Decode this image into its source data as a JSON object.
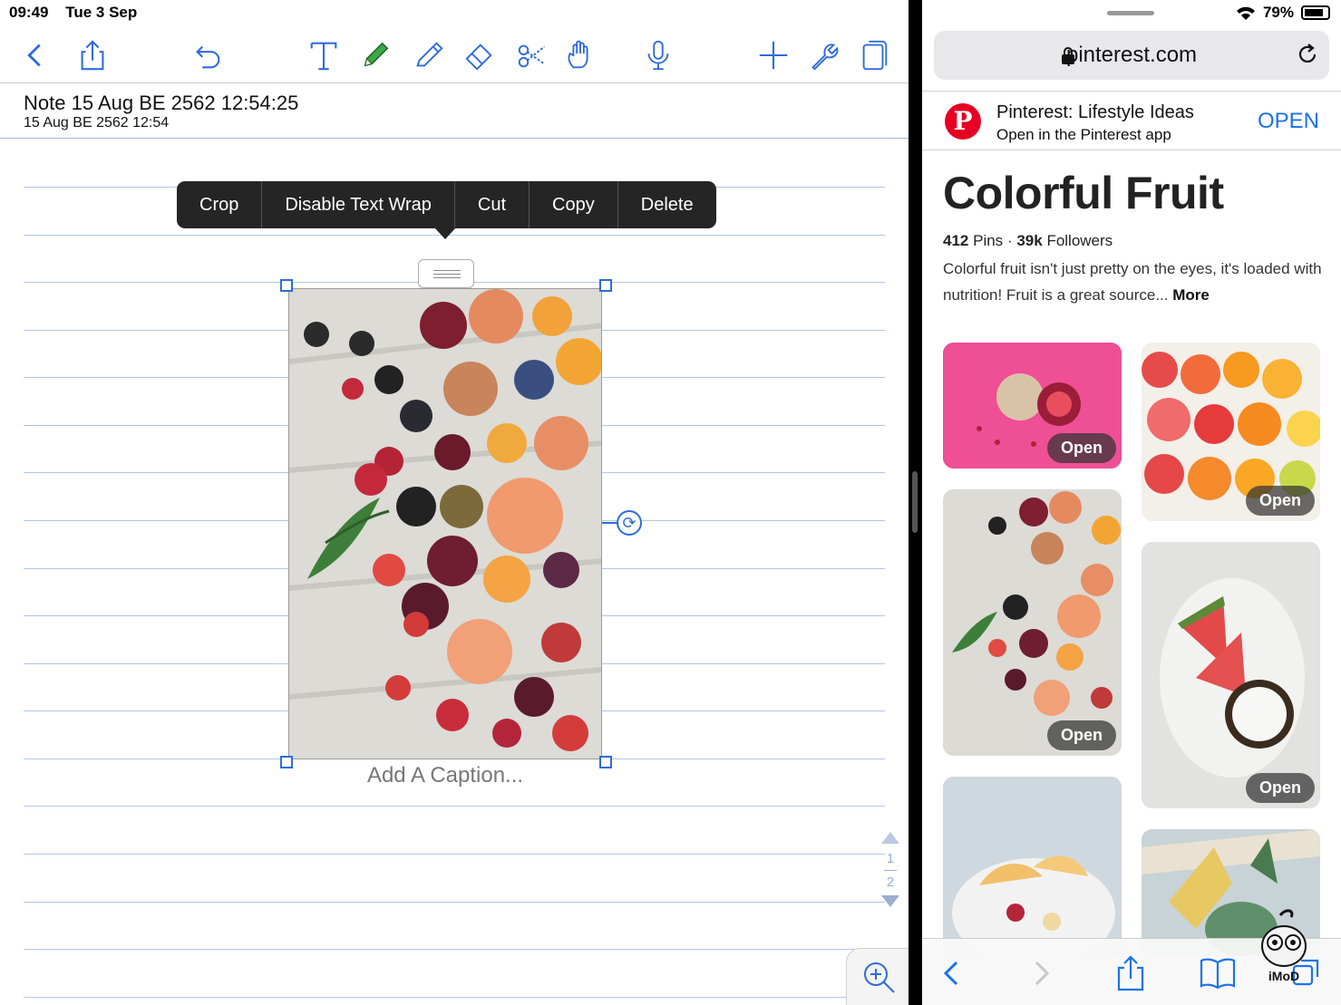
{
  "status_left": {
    "time": "09:49",
    "date": "Tue 3 Sep"
  },
  "status_right": {
    "battery": "79%"
  },
  "notes_app": {
    "note_title": "Note 15 Aug BE 2562 12:54:25",
    "note_date": "15 Aug BE 2562 12:54",
    "context_menu": [
      "Crop",
      "Disable Text Wrap",
      "Cut",
      "Copy",
      "Delete"
    ],
    "caption_placeholder": "Add A Caption...",
    "pager": {
      "page_a": "1",
      "page_b": "2"
    }
  },
  "safari": {
    "url": "pinterest.com",
    "banner": {
      "title": "Pinterest: Lifestyle Ideas",
      "subtitle": "Open in the Pinterest app",
      "open": "OPEN"
    },
    "board": {
      "title": "Colorful Fruit",
      "pins_count": "412",
      "pins_label": "Pins",
      "separator": "·",
      "followers_count": "39k",
      "followers_label": "Followers",
      "description": "Colorful fruit isn't just pretty on the eyes, it's loaded with nutrition! Fruit is a great source...",
      "more": "More"
    },
    "pin_open_label": "Open"
  },
  "watermark": "iMoD",
  "colors": {
    "accent_blue": "#2f6bdb",
    "pinterest_red": "#e60023",
    "green_pen": "#3aa845"
  }
}
